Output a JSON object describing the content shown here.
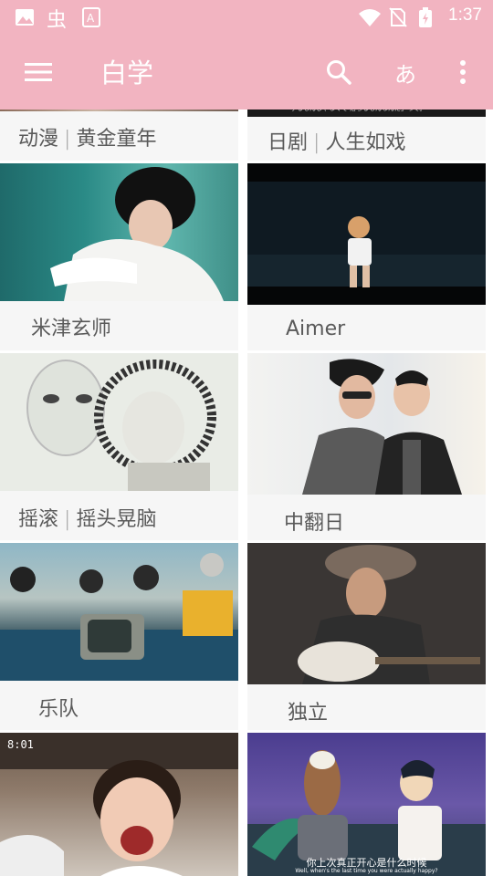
{
  "status_bar": {
    "time": "1:37",
    "icons": [
      "image-icon",
      "chong-app-icon",
      "a-app-icon",
      "wifi-icon",
      "no-sim-icon",
      "battery-charging-icon"
    ]
  },
  "app_bar": {
    "title": "白学",
    "kana_button": "あ",
    "icons": [
      "menu-icon",
      "search-icon",
      "more-vert-icon"
    ]
  },
  "colors": {
    "accent": "#f2b4c1",
    "caption_bg": "#f6f6f6",
    "text": "#5a5a5a"
  },
  "cards": [
    {
      "id": "anime",
      "label_a": "动漫",
      "label_b": "黄金童年"
    },
    {
      "id": "drama",
      "label_a": "日剧",
      "label_b": "人生如戏"
    },
    {
      "id": "yonezu",
      "label": "米津玄师"
    },
    {
      "id": "aimer",
      "label": "Aimer"
    },
    {
      "id": "rock",
      "label_a": "摇滚",
      "label_b": "摇头晃脑"
    },
    {
      "id": "zhongfan",
      "label": "中翻日"
    },
    {
      "id": "band",
      "label": "乐队"
    },
    {
      "id": "indie",
      "label": "独立"
    },
    {
      "id": "ninetimes",
      "overlay_text": "8:01"
    },
    {
      "id": "bojack",
      "subtitle_cn": "你上次真正开心是什么时候",
      "subtitle_en": "Well, when's the last time you were actually happy?"
    }
  ],
  "drama_top_caption": "「するもんじゃなくて 落ちるもんなんだ」って。"
}
